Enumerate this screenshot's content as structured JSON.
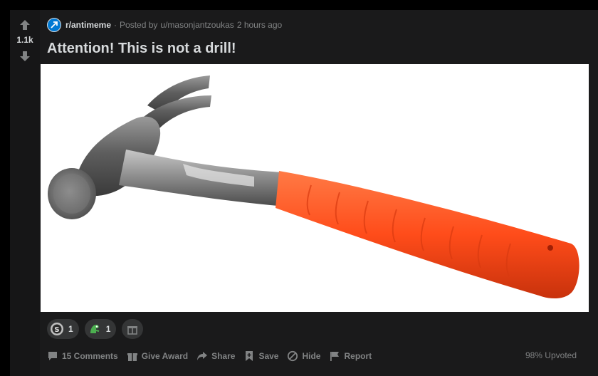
{
  "post": {
    "score": "1.1k",
    "subreddit": "r/antimeme",
    "separator": "·",
    "posted_by": "Posted by",
    "username": "u/masonjantzoukas",
    "time_ago": "2 hours ago",
    "title": "Attention! This is not a drill!",
    "image_subject": "claw hammer with orange rubber grip",
    "awards": [
      {
        "icon": "silver-award-icon",
        "count": "1"
      },
      {
        "icon": "dinosaur-award-icon",
        "count": "1"
      }
    ],
    "actions": {
      "comments": "15 Comments",
      "give_award": "Give Award",
      "share": "Share",
      "save": "Save",
      "hide": "Hide",
      "report": "Report"
    },
    "upvoted": "98% Upvoted"
  },
  "colors": {
    "background": "#000000",
    "card": "#1a1a1b",
    "vote_column": "#161617",
    "text_primary": "#d7dadc",
    "text_muted": "#818384",
    "pill": "#343536",
    "subreddit_icon": "#0079d3",
    "hammer_grip": "#ff4c1a"
  }
}
